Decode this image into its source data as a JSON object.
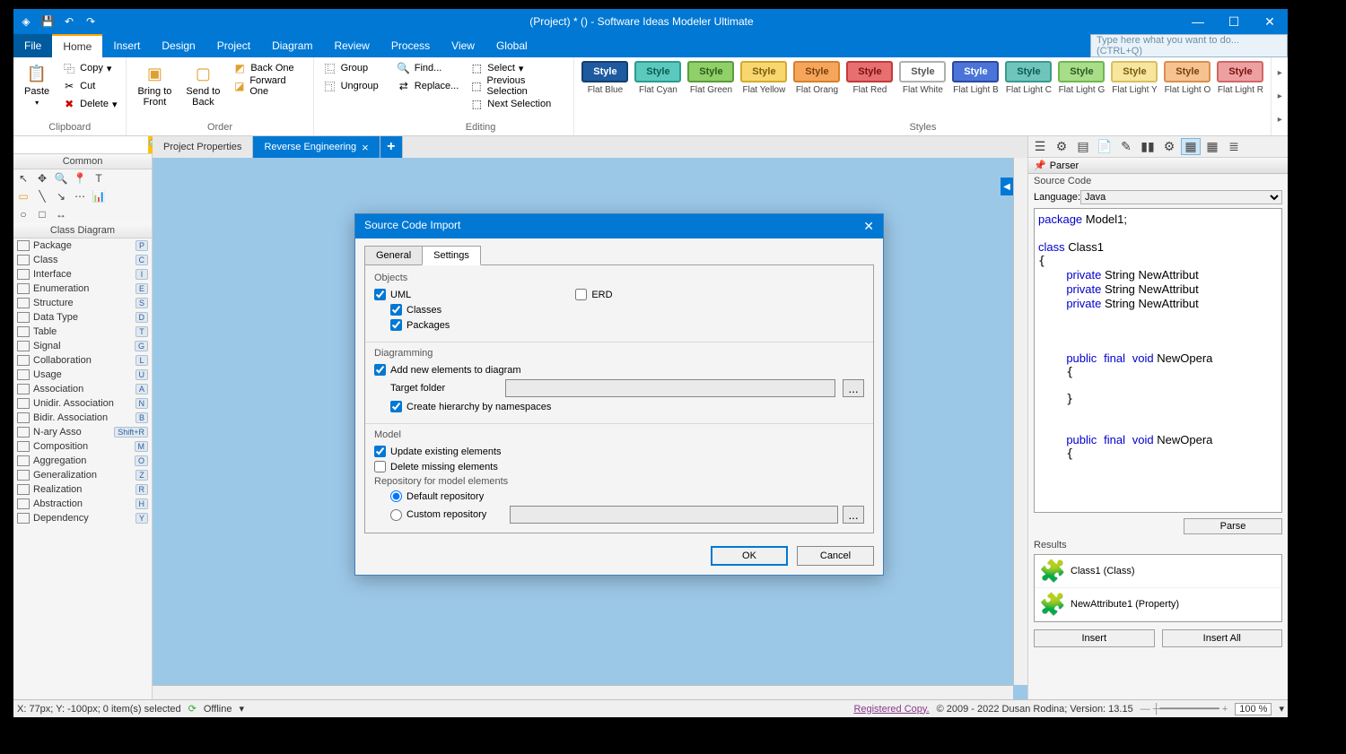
{
  "titlebar": {
    "title": "(Project) *  () - Software Ideas Modeler Ultimate"
  },
  "menubar": {
    "file": "File",
    "home": "Home",
    "insert": "Insert",
    "design": "Design",
    "project": "Project",
    "diagram": "Diagram",
    "review": "Review",
    "process": "Process",
    "view": "View",
    "global": "Global",
    "search_placeholder": "Type here what you want to do...   (CTRL+Q)"
  },
  "ribbon": {
    "clipboard": {
      "label": "Clipboard",
      "paste": "Paste",
      "copy": "Copy",
      "cut": "Cut",
      "delete": "Delete"
    },
    "order": {
      "label": "Order",
      "bring_front": "Bring to\nFront",
      "send_back": "Send to\nBack",
      "back_one": "Back One",
      "forward_one": "Forward One"
    },
    "group": {
      "group": "Group",
      "ungroup": "Ungroup"
    },
    "editing": {
      "label": "Editing",
      "find": "Find...",
      "replace": "Replace...",
      "select": "Select",
      "prev_sel": "Previous Selection",
      "next_sel": "Next Selection"
    },
    "styles_label": "Styles",
    "styles": [
      {
        "name": "Flat Blue",
        "bg": "#1e5aa0",
        "border": "#13406f",
        "fg": "#ffffff"
      },
      {
        "name": "Flat Cyan",
        "bg": "#5cc9be",
        "border": "#2a9d8f",
        "fg": "#0b5a50"
      },
      {
        "name": "Flat Green",
        "bg": "#8fd068",
        "border": "#5a9c3f",
        "fg": "#2d5a1f"
      },
      {
        "name": "Flat Yellow",
        "bg": "#f8d76e",
        "border": "#d4aa30",
        "fg": "#7a5c10"
      },
      {
        "name": "Flat Orang",
        "bg": "#f6a65a",
        "border": "#d67f2e",
        "fg": "#7a3f10"
      },
      {
        "name": "Flat Red",
        "bg": "#e76f6f",
        "border": "#c23b3b",
        "fg": "#7a1010"
      },
      {
        "name": "Flat White",
        "bg": "#ffffff",
        "border": "#b0b0b0",
        "fg": "#555555"
      },
      {
        "name": "Flat Light B",
        "bg": "#4a74d8",
        "border": "#2a4aa0",
        "fg": "#ffffff"
      },
      {
        "name": "Flat Light C",
        "bg": "#6fc5bb",
        "border": "#3a9a8e",
        "fg": "#0b5a50"
      },
      {
        "name": "Flat Light G",
        "bg": "#a8dd8a",
        "border": "#6fb850",
        "fg": "#2d5a1f"
      },
      {
        "name": "Flat Light Y",
        "bg": "#f8e69e",
        "border": "#d8c060",
        "fg": "#7a5c10"
      },
      {
        "name": "Flat Light O",
        "bg": "#f6c290",
        "border": "#d89050",
        "fg": "#7a3f10"
      },
      {
        "name": "Flat Light R",
        "bg": "#eda0a0",
        "border": "#d06868",
        "fg": "#7a1010"
      }
    ],
    "style_text": "Style"
  },
  "left": {
    "common": "Common",
    "class_diagram": "Class Diagram",
    "items": [
      {
        "label": "Package",
        "key": "P"
      },
      {
        "label": "Class",
        "key": "C"
      },
      {
        "label": "Interface",
        "key": "I"
      },
      {
        "label": "Enumeration",
        "key": "E"
      },
      {
        "label": "Structure",
        "key": "S"
      },
      {
        "label": "Data Type",
        "key": "D"
      },
      {
        "label": "Table",
        "key": "T"
      },
      {
        "label": "Signal",
        "key": "G"
      },
      {
        "label": "Collaboration",
        "key": "L"
      },
      {
        "label": "Usage",
        "key": "U"
      },
      {
        "label": "Association",
        "key": "A"
      },
      {
        "label": "Unidir. Association",
        "key": "N"
      },
      {
        "label": "Bidir. Association",
        "key": "B"
      },
      {
        "label": "N-ary Asso",
        "key": "Shift+R"
      },
      {
        "label": "Composition",
        "key": "M"
      },
      {
        "label": "Aggregation",
        "key": "O"
      },
      {
        "label": "Generalization",
        "key": "Z"
      },
      {
        "label": "Realization",
        "key": "R"
      },
      {
        "label": "Abstraction",
        "key": "H"
      },
      {
        "label": "Dependency",
        "key": "Y"
      }
    ]
  },
  "tabs": {
    "t1": "Project Properties",
    "t2": "Reverse Engineering"
  },
  "dialog": {
    "title": "Source Code Import",
    "tab_general": "General",
    "tab_settings": "Settings",
    "objects": "Objects",
    "uml": "UML",
    "erd": "ERD",
    "classes": "Classes",
    "packages": "Packages",
    "diagramming": "Diagramming",
    "add_new": "Add new elements to diagram",
    "target_folder": "Target folder",
    "create_hierarchy": "Create hierarchy by namespaces",
    "model": "Model",
    "update_existing": "Update existing elements",
    "delete_missing": "Delete missing elements",
    "repo_label": "Repository for model elements",
    "repo_default": "Default repository",
    "repo_custom": "Custom repository",
    "ok": "OK",
    "cancel": "Cancel",
    "browse": "..."
  },
  "right": {
    "parser": "Parser",
    "source_code": "Source Code",
    "language": "Language:",
    "lang_val": "Java",
    "code_kw_package": "package",
    "code_model": " Model1;",
    "code_kw_class": "class",
    "code_class": " Class1",
    "code_kw_priv": "private",
    "code_attr1": " String NewAttribut",
    "code_attr2": " String NewAttribut",
    "code_attr3": " String NewAttribut",
    "code_kw_pub": "public",
    "code_kw_final": "final",
    "code_kw_void": "void",
    "code_op": " NewOpera",
    "parse": "Parse",
    "results": "Results",
    "res1": "Class1 (Class)",
    "res2": "NewAttribute1 (Property)",
    "insert": "Insert",
    "insert_all": "Insert All"
  },
  "status": {
    "coords": "X: 77px; Y: -100px; 0 item(s) selected",
    "offline": "Offline",
    "reg": "Registered Copy.",
    "copy": "© 2009 - 2022 Dusan Rodina; Version: 13.15",
    "zoom": "100 %"
  }
}
